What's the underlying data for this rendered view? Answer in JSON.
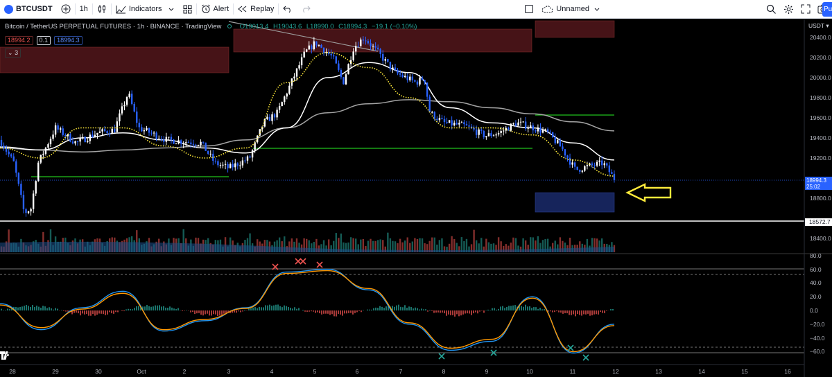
{
  "toolbar": {
    "symbol": "BTCUSDT",
    "interval": "1h",
    "indicators": "Indicators",
    "alert": "Alert",
    "replay": "Replay",
    "layout_name": "Unnamed",
    "publish": "Pu"
  },
  "legend": {
    "title": "Bitcoin / TetherUS PERPETUAL FUTURES · 1h · BINANCE · TradingView",
    "ohlc_o": "O19013.4",
    "ohlc_h": "H19043.6",
    "ohlc_l": "L18990.0",
    "ohlc_c": "C18994.3",
    "ohlc_change": "−19.1 (−0.10%)",
    "bid": "18994.2",
    "spread": "0.1",
    "ask": "18994.3",
    "indicator_count": "3"
  },
  "price_scale": {
    "currency": "USDT ▾",
    "labels": [
      "20400.0",
      "20200.0",
      "20000.0",
      "19800.0",
      "19600.0",
      "19400.0",
      "19200.0",
      "18800.0",
      "18400.0"
    ],
    "last_price": "18994.3",
    "countdown": "25:02",
    "hline_price": "18572.7"
  },
  "osc_scale": {
    "labels": [
      "80.0",
      "60.0",
      "40.0",
      "20.0",
      "0.0",
      "−20.0",
      "−40.0",
      "−60.0"
    ]
  },
  "time_axis": {
    "labels": [
      "28",
      "29",
      "30",
      "Oct",
      "2",
      "3",
      "4",
      "5",
      "6",
      "7",
      "8",
      "9",
      "10",
      "11",
      "12",
      "13",
      "14",
      "15",
      "16"
    ]
  },
  "colors": {
    "bg": "#000000",
    "candle_up": "#ffffff",
    "candle_down": "#2962ff",
    "zone_supply": "#5d1a1f",
    "zone_demand": "#1a2a6b",
    "level_line": "#21c21e",
    "arrow": "#ffeb3b",
    "ema_fast": "#ffeb3b",
    "ema_mid": "#ffffff",
    "ema_slow": "#9e9e9e"
  },
  "chart_data": {
    "type": "candlestick",
    "title": "Bitcoin / TetherUS PERPETUAL FUTURES · 1h · BINANCE · TradingView",
    "ylim": [
      18470,
      20660
    ],
    "x": [
      "28",
      "29",
      "30",
      "Oct",
      "2",
      "3",
      "4",
      "5",
      "6",
      "7",
      "8",
      "9",
      "10",
      "11",
      "12"
    ],
    "close": [
      19350,
      19050,
      19450,
      19550,
      19310,
      19150,
      19250,
      19900,
      20300,
      20150,
      19850,
      19500,
      19500,
      19420,
      19150,
      18994.3
    ],
    "ema_slow": [
      19300,
      19280,
      19260,
      19280,
      19300,
      19320,
      19380,
      19500,
      19650,
      19740,
      19780,
      19760,
      19700,
      19640,
      19560,
      19470
    ],
    "ema_mid": [
      19310,
      19280,
      19400,
      19450,
      19380,
      19300,
      19250,
      19500,
      20000,
      20150,
      20050,
      19700,
      19550,
      19500,
      19350,
      19180
    ],
    "ema_fast": [
      19300,
      19200,
      19500,
      19500,
      19320,
      19200,
      19300,
      19950,
      20250,
      20100,
      19800,
      19500,
      19500,
      19430,
      19180,
      19020
    ],
    "levels": [
      19250,
      19330,
      19640
    ],
    "hline": 18572.7,
    "oscillator": {
      "ylim": [
        -70,
        80
      ],
      "levels": [
        54,
        -54
      ],
      "k": [
        10,
        -28,
        4,
        28,
        -30,
        -15,
        4,
        56,
        60,
        30,
        -20,
        -58,
        -45,
        20,
        -62,
        -20
      ],
      "d": [
        8,
        -25,
        2,
        25,
        -28,
        -13,
        3,
        54,
        58,
        32,
        -18,
        -55,
        -42,
        18,
        -60,
        -22
      ],
      "cross_overbought_times": [
        "4",
        "5",
        "5",
        "5"
      ],
      "cross_oversold_times": [
        "8",
        "9",
        "11",
        "11"
      ]
    }
  }
}
